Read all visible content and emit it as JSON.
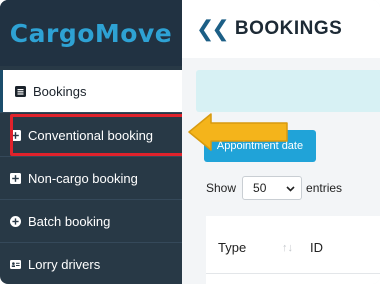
{
  "sidebar": {
    "logo": "CargoMove",
    "items": [
      {
        "label": "Bookings",
        "icon": "list-icon",
        "active": true
      },
      {
        "label": "Conventional booking",
        "icon": "plus-square-icon",
        "active": false
      },
      {
        "label": "Non-cargo booking",
        "icon": "plus-square-icon",
        "active": false
      },
      {
        "label": "Batch booking",
        "icon": "plus-circle-icon",
        "active": false
      },
      {
        "label": "Lorry drivers",
        "icon": "id-card-icon",
        "active": false
      }
    ]
  },
  "header": {
    "back_icon": "double-chevron-left-icon",
    "title": "BOOKINGS"
  },
  "main": {
    "appointment_button": "Appointment date",
    "show_label": "Show",
    "entries_value": "50",
    "entries_label": "entries",
    "table": {
      "columns": [
        "Type",
        "ID"
      ]
    }
  },
  "annotation": {
    "highlight_color": "#e0222b",
    "arrow_color": "#f4b41b"
  },
  "colors": {
    "sidebar_bg": "#283946",
    "logo_color": "#2ea2d4",
    "accent_button": "#20a3d8",
    "banner_bg": "#d7f1f4"
  }
}
